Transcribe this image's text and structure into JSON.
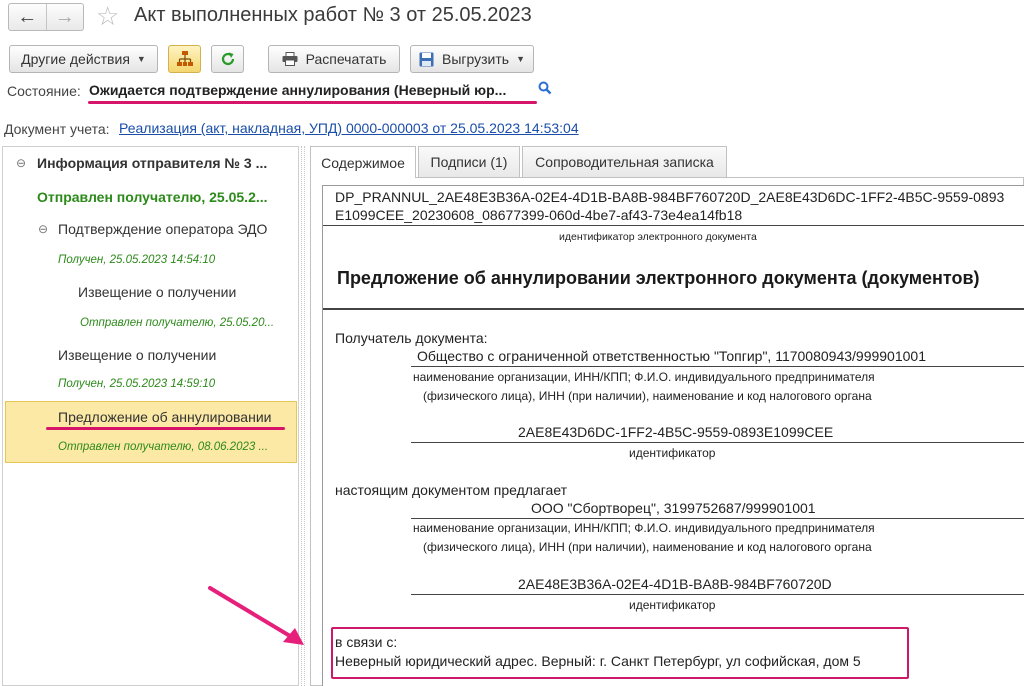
{
  "window": {
    "title": "Акт выполненных работ № 3 от 25.05.2023",
    "back_icon": "arrow-left-icon",
    "forward_icon": "arrow-right-icon",
    "favorite_icon": "star-icon"
  },
  "toolbar": {
    "other_actions": "Другие действия",
    "structure_icon": "hierarchy-icon",
    "refresh_icon": "refresh-icon",
    "print": "Распечатать",
    "export": "Выгрузить"
  },
  "state": {
    "label": "Состояние:",
    "value": "Ожидается подтверждение аннулирования (Неверный юр..."
  },
  "accounting_doc": {
    "label": "Документ учета:",
    "link": "Реализация (акт, накладная, УПД) 0000-000003 от 25.05.2023 14:53:04"
  },
  "tree": {
    "items": [
      {
        "label": "Информация отправителя № 3 ...",
        "toggle": "⊖"
      },
      {
        "label": "Отправлен получателю, 25.05.2..."
      },
      {
        "label": "Подтверждение оператора ЭДО",
        "toggle": "⊖"
      },
      {
        "label": "Получен, 25.05.2023 14:54:10"
      },
      {
        "label": "Извещение о получении"
      },
      {
        "label": "Отправлен получателю, 25.05.20..."
      },
      {
        "label": "Извещение о получении"
      },
      {
        "label": "Получен, 25.05.2023 14:59:10"
      },
      {
        "label": "Предложение об аннулировании"
      },
      {
        "label": "Отправлен получателю, 08.06.2023 ..."
      }
    ]
  },
  "tabs": [
    "Содержимое",
    "Подписи (1)",
    "Сопроводительная записка"
  ],
  "document": {
    "file_id_line1": "DP_PRANNUL_2AE48E3B36A-02E4-4D1B-BA8B-984BF760720D_2AE8E43D6DC-1FF2-4B5C-9559-0893",
    "file_id_line2": "E1099CEE_20230608_08677399-060d-4be7-af43-73e4ea14fb18",
    "file_id_caption": "идентификатор электронного документа",
    "heading": "Предложение об аннулировании электронного документа (документов)",
    "recipient_label": "Получатель документа:",
    "recipient_value": "Общество с ограниченной ответственностью \"Топгир\", 1170080943/999901001",
    "org_caption_1": "наименование организации, ИНН/КПП; Ф.И.О. индивидуального предпринимателя",
    "org_caption_2": "(физического лица), ИНН (при наличии), наименование и код налогового органа",
    "recipient_id": "2AE8E43D6DC-1FF2-4B5C-9559-0893E1099CEE",
    "id_caption": "идентификатор",
    "proposes_label": "настоящим документом предлагает",
    "sender_value": "ООО \"Сбортворец\", 3199752687/999901001",
    "sender_id": "2AE48E3B36A-02E4-4D1B-BA8B-984BF760720D",
    "reason_label": "в связи с:",
    "reason_value": "Неверный юридический адрес. Верный: г. Санкт Петербург, ул софийская, дом 5"
  },
  "colors": {
    "highlight": "#d6156a",
    "link": "#1a4ea8",
    "green_status": "#2c8a1a",
    "selected_row": "#fbe9a5"
  }
}
